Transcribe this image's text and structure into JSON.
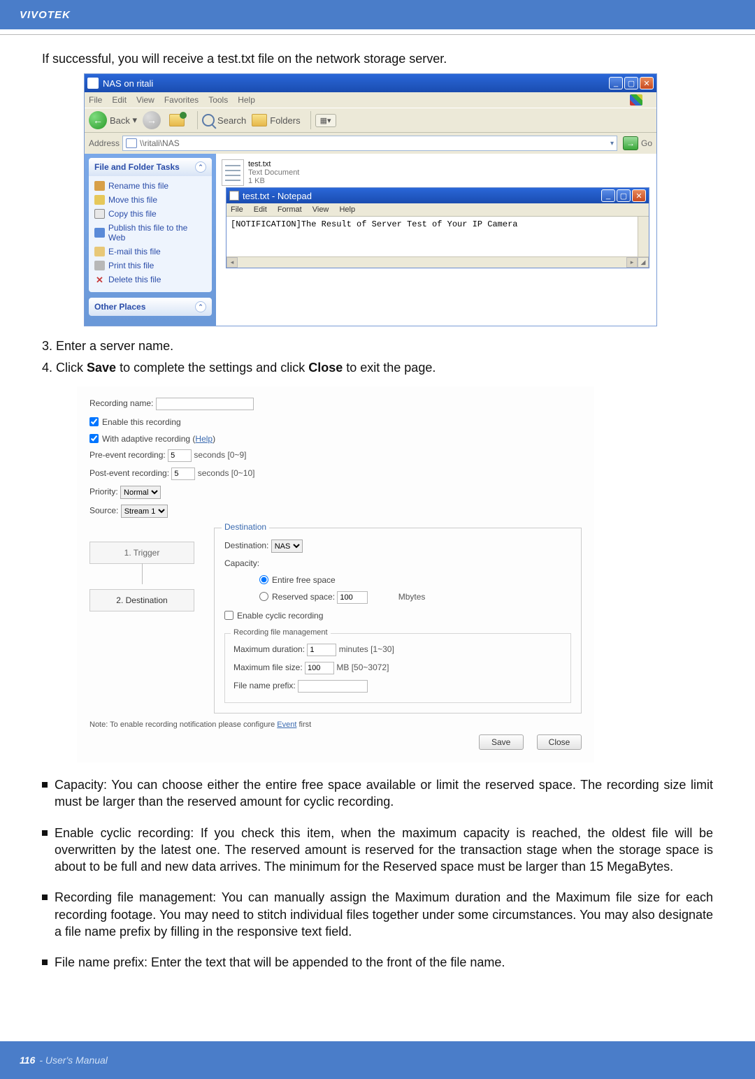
{
  "brand": "VIVOTEK",
  "intro": "If successful, you will receive a test.txt file on the network storage server.",
  "explorer": {
    "title": "NAS on ritali",
    "menu": {
      "file": "File",
      "edit": "Edit",
      "view": "View",
      "favorites": "Favorites",
      "tools": "Tools",
      "help": "Help"
    },
    "toolbar": {
      "back": "Back",
      "search": "Search",
      "folders": "Folders"
    },
    "address_label": "Address",
    "address_value": "\\\\ritali\\NAS",
    "go": "Go",
    "pane_title": "File and Folder Tasks",
    "tasks": {
      "rename": "Rename this file",
      "move": "Move this file",
      "copy": "Copy this file",
      "publish": "Publish this file to the Web",
      "email": "E-mail this file",
      "print": "Print this file",
      "del": "Delete this file"
    },
    "other_places": "Other Places",
    "file": {
      "name": "test.txt",
      "type": "Text Document",
      "size": "1 KB"
    },
    "notepad": {
      "title": "test.txt - Notepad",
      "menu": {
        "file": "File",
        "edit": "Edit",
        "format": "Format",
        "view": "View",
        "help": "Help"
      },
      "body": "[NOTIFICATION]The Result of Server Test of Your IP Camera"
    }
  },
  "step3": "3. Enter a server name.",
  "step4_a": "4. Click ",
  "step4_b": "Save",
  "step4_c": " to complete the settings and click ",
  "step4_d": "Close",
  "step4_e": " to exit the page.",
  "settings": {
    "rec_name_label": "Recording name:",
    "enable_rec": "Enable this recording",
    "adaptive": "With adaptive recording (",
    "help": "Help",
    "pre_label": "Pre-event recording:",
    "pre_val": "5",
    "pre_unit": "seconds [0~9]",
    "post_label": "Post-event recording:",
    "post_val": "5",
    "post_unit": "seconds [0~10]",
    "priority_label": "Priority:",
    "priority_val": "Normal",
    "source_label": "Source:",
    "source_val": "Stream 1",
    "step1": "1. Trigger",
    "step2": "2. Destination",
    "dest_legend": "Destination",
    "dest_label": "Destination:",
    "dest_val": "NAS",
    "capacity": "Capacity:",
    "entire": "Entire free space",
    "reserved": "Reserved space:",
    "reserved_val": "100",
    "reserved_unit": "Mbytes",
    "cyclic": "Enable cyclic recording",
    "file_mgmt": "Recording file management",
    "maxdur": "Maximum duration:",
    "maxdur_val": "1",
    "maxdur_unit": "minutes [1~30]",
    "maxsize": "Maximum file size:",
    "maxsize_val": "100",
    "maxsize_unit": "MB [50~3072]",
    "prefix": "File name prefix:",
    "note_a": "Note: To enable recording notification please configure ",
    "note_link": "Event",
    "note_b": " first",
    "save": "Save",
    "close": "Close"
  },
  "bullets": {
    "b1": "Capacity: You can choose either the entire free space available or limit the reserved space. The recording size limit must be larger than the reserved amount for cyclic recording.",
    "b2": "Enable cyclic recording: If you check this item, when the maximum capacity is reached, the oldest file will be overwritten by the latest one. The reserved amount is reserved for the transaction stage when the storage space is about to be full and new data arrives. The minimum for the Reserved space must be larger than 15 MegaBytes.",
    "b3": "Recording file management: You can manually assign the Maximum duration and the Maximum file size for each recording footage. You may need to stitch individual files together under some circumstances. You may also designate a file name prefix by filling in the responsive text field.",
    "b4": "File name prefix: Enter the text that will be appended to the front of the file name."
  },
  "footer": {
    "page": "116",
    "label": " - User's Manual"
  }
}
